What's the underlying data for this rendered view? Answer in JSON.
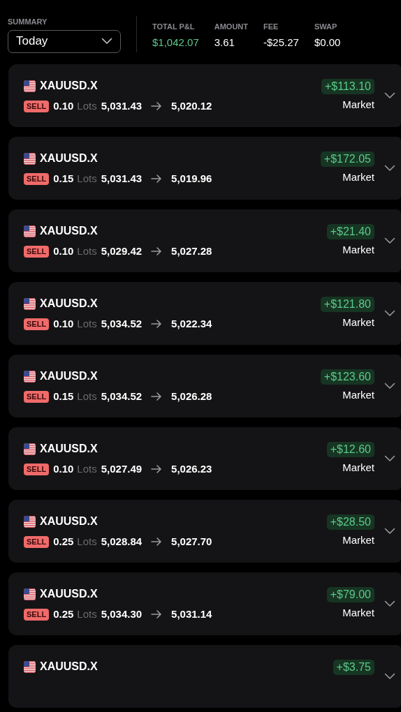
{
  "summary": {
    "label": "SUMMARY",
    "period": "Today"
  },
  "stats": [
    {
      "label": "TOTAL P&L",
      "value": "$1,042.07",
      "kind": "profit"
    },
    {
      "label": "AMOUNT",
      "value": "3.61",
      "kind": "plain"
    },
    {
      "label": "FEE",
      "value": "-$25.27",
      "kind": "plain"
    },
    {
      "label": "SWAP",
      "value": "$0.00",
      "kind": "plain"
    }
  ],
  "trades": [
    {
      "symbol": "XAUUSD.X",
      "pnl": "+$113.10",
      "side": "SELL",
      "lots": "0.10",
      "lots_unit": "Lots",
      "open": "5,031.43",
      "close": "5,020.12",
      "order_type": "Market"
    },
    {
      "symbol": "XAUUSD.X",
      "pnl": "+$172.05",
      "side": "SELL",
      "lots": "0.15",
      "lots_unit": "Lots",
      "open": "5,031.43",
      "close": "5,019.96",
      "order_type": "Market"
    },
    {
      "symbol": "XAUUSD.X",
      "pnl": "+$21.40",
      "side": "SELL",
      "lots": "0.10",
      "lots_unit": "Lots",
      "open": "5,029.42",
      "close": "5,027.28",
      "order_type": "Market"
    },
    {
      "symbol": "XAUUSD.X",
      "pnl": "+$121.80",
      "side": "SELL",
      "lots": "0.10",
      "lots_unit": "Lots",
      "open": "5,034.52",
      "close": "5,022.34",
      "order_type": "Market"
    },
    {
      "symbol": "XAUUSD.X",
      "pnl": "+$123.60",
      "side": "SELL",
      "lots": "0.15",
      "lots_unit": "Lots",
      "open": "5,034.52",
      "close": "5,026.28",
      "order_type": "Market"
    },
    {
      "symbol": "XAUUSD.X",
      "pnl": "+$12.60",
      "side": "SELL",
      "lots": "0.10",
      "lots_unit": "Lots",
      "open": "5,027.49",
      "close": "5,026.23",
      "order_type": "Market"
    },
    {
      "symbol": "XAUUSD.X",
      "pnl": "+$28.50",
      "side": "SELL",
      "lots": "0.25",
      "lots_unit": "Lots",
      "open": "5,028.84",
      "close": "5,027.70",
      "order_type": "Market"
    },
    {
      "symbol": "XAUUSD.X",
      "pnl": "+$79.00",
      "side": "SELL",
      "lots": "0.25",
      "lots_unit": "Lots",
      "open": "5,034.30",
      "close": "5,031.14",
      "order_type": "Market"
    },
    {
      "symbol": "XAUUSD.X",
      "pnl": "+$3.75"
    }
  ]
}
